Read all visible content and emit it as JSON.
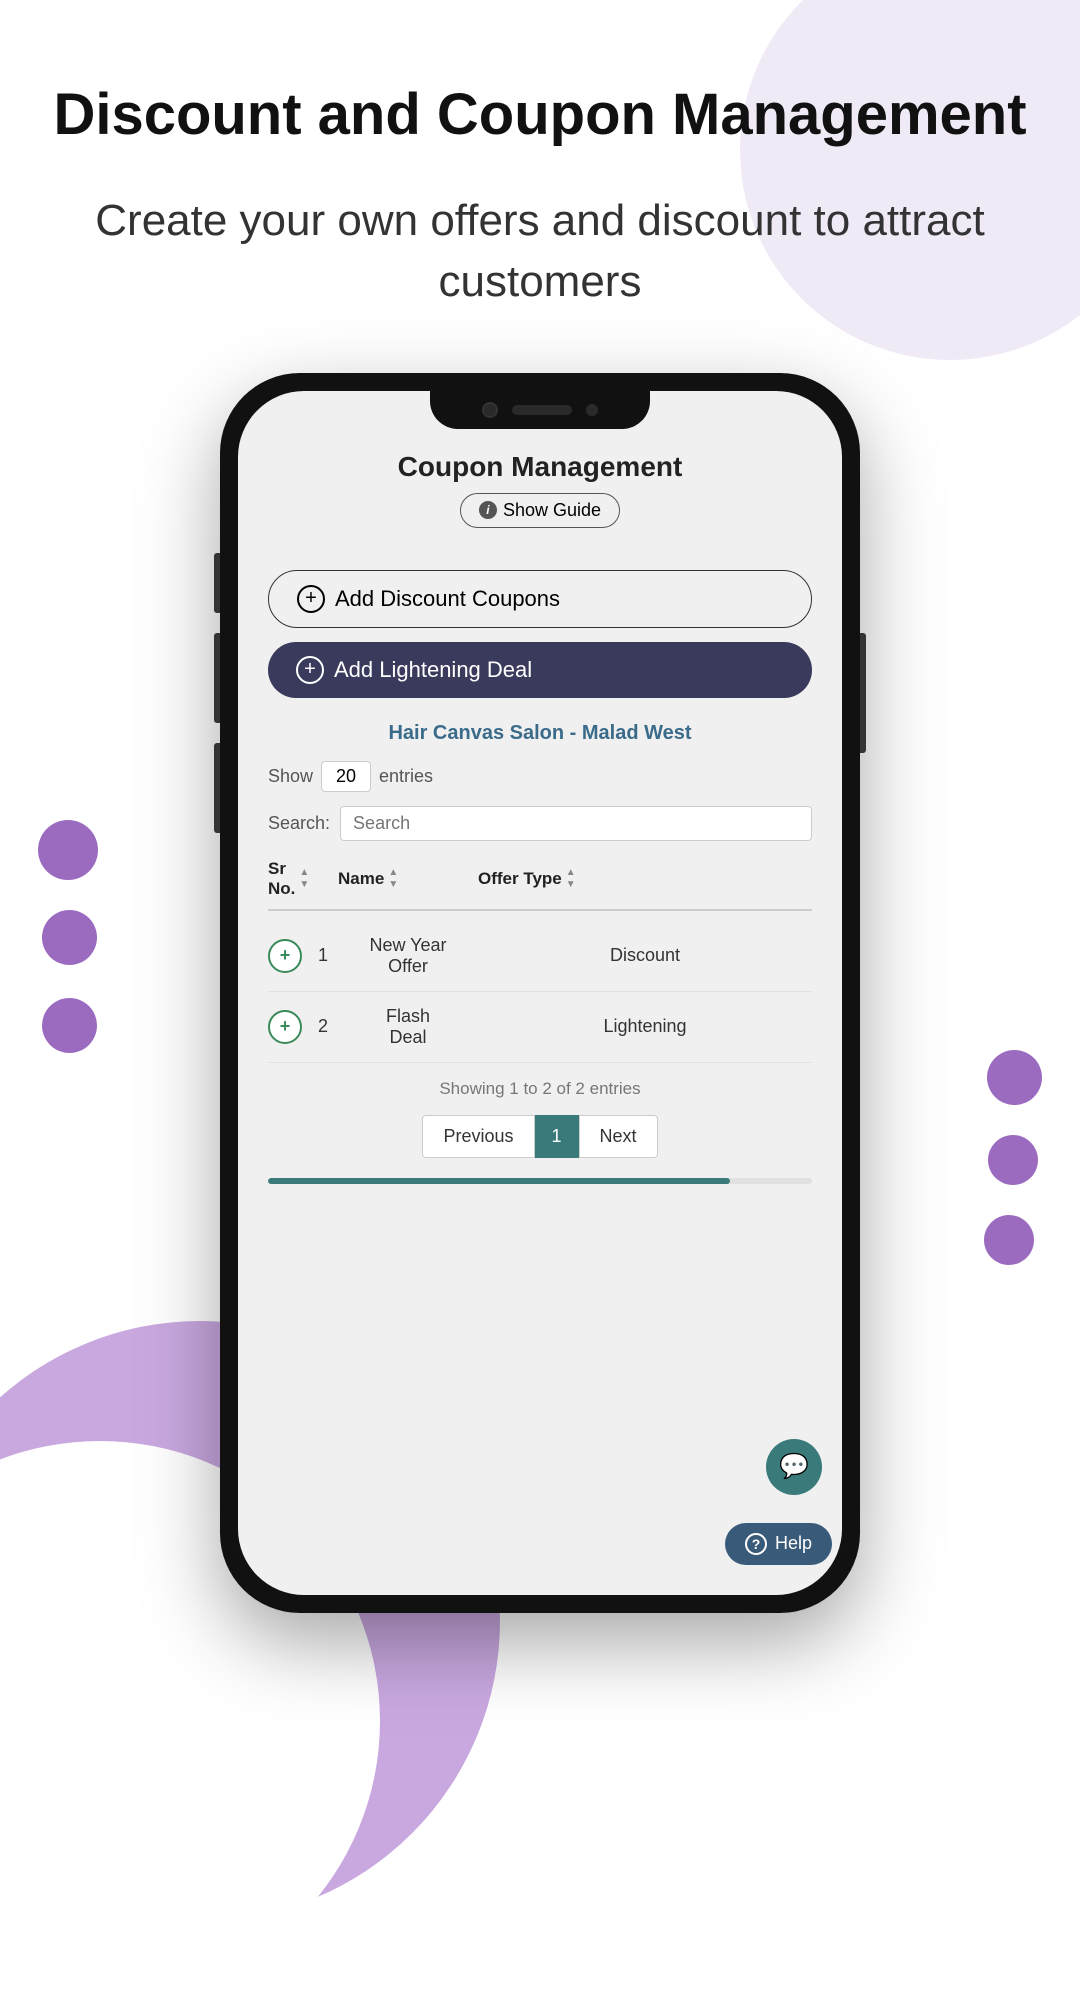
{
  "page": {
    "header_title": "Discount and Coupon Management",
    "header_subtitle": "Create your own offers and discount to attract customers"
  },
  "phone": {
    "screen_title": "Coupon Management",
    "show_guide_label": "Show Guide",
    "add_coupon_label": "Add Discount Coupons",
    "add_lightning_label": "Add Lightening Deal",
    "salon_name": "Hair Canvas Salon - Malad West",
    "entries_label_pre": "Show",
    "entries_value": "20",
    "entries_label_post": "entries",
    "search_label": "Search:",
    "search_placeholder": "Search",
    "table": {
      "col1": "Sr No.",
      "col2": "Name",
      "col3": "Offer Type",
      "rows": [
        {
          "num": "1",
          "name": "New Year Offer",
          "offer": "Discount"
        },
        {
          "num": "2",
          "name": "Flash Deal",
          "offer": "Lightening"
        }
      ]
    },
    "showing_text": "Showing 1 to 2 of 2 entries",
    "prev_label": "Previous",
    "page_num": "1",
    "next_label": "Next",
    "chat_icon": "💬",
    "help_label": "Help",
    "help_icon": "?"
  },
  "colors": {
    "teal": "#3a7a7a",
    "dark_navy": "#3a3a5c",
    "purple": "#9b6bbf",
    "light_purple_bg": "#f0eaf7",
    "salon_blue": "#3a6b8a"
  }
}
